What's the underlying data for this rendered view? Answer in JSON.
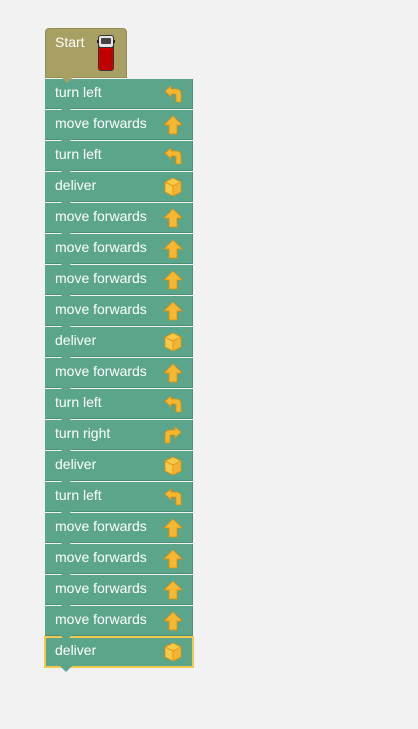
{
  "start": {
    "label": "Start",
    "icon": "van-icon"
  },
  "colors": {
    "workspace_bg": "#f2f2f2",
    "start_block": "#a89f63",
    "action_block": "#5ba68a",
    "selected_outline": "#f2c94c",
    "icon_yellow": "#f7b731"
  },
  "blocks": [
    {
      "label": "turn left",
      "icon": "turn-left-icon"
    },
    {
      "label": "move forwards",
      "icon": "arrow-up-icon"
    },
    {
      "label": "turn left",
      "icon": "turn-left-icon"
    },
    {
      "label": "deliver",
      "icon": "box-icon"
    },
    {
      "label": "move forwards",
      "icon": "arrow-up-icon"
    },
    {
      "label": "move forwards",
      "icon": "arrow-up-icon"
    },
    {
      "label": "move forwards",
      "icon": "arrow-up-icon"
    },
    {
      "label": "move forwards",
      "icon": "arrow-up-icon"
    },
    {
      "label": "deliver",
      "icon": "box-icon"
    },
    {
      "label": "move forwards",
      "icon": "arrow-up-icon"
    },
    {
      "label": "turn left",
      "icon": "turn-left-icon"
    },
    {
      "label": "turn right",
      "icon": "turn-right-icon"
    },
    {
      "label": "deliver",
      "icon": "box-icon"
    },
    {
      "label": "turn left",
      "icon": "turn-left-icon"
    },
    {
      "label": "move forwards",
      "icon": "arrow-up-icon"
    },
    {
      "label": "move forwards",
      "icon": "arrow-up-icon"
    },
    {
      "label": "move forwards",
      "icon": "arrow-up-icon"
    },
    {
      "label": "move forwards",
      "icon": "arrow-up-icon"
    },
    {
      "label": "deliver",
      "icon": "box-icon",
      "selected": true
    }
  ]
}
